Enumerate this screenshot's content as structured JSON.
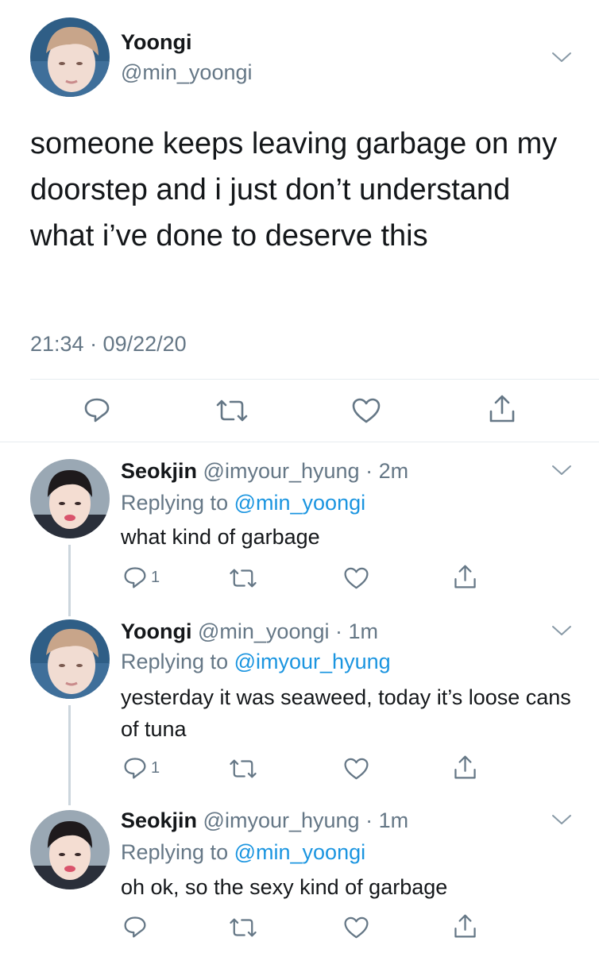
{
  "main_tweet": {
    "display_name": "Yoongi",
    "handle": "@min_yoongi",
    "text": "someone keeps leaving garbage on my doorstep and i just don’t understand what i’ve done to deserve this",
    "timestamp": "21:34 · 09/22/20"
  },
  "replies": [
    {
      "display_name": "Seokjin",
      "handle": "@imyour_hyung",
      "time": "· 2m",
      "replying_label": "Replying to",
      "replying_to": "@min_yoongi",
      "text": "what kind of garbage",
      "reply_count": "1"
    },
    {
      "display_name": "Yoongi",
      "handle": "@min_yoongi",
      "time": "· 1m",
      "replying_label": "Replying to",
      "replying_to": "@imyour_hyung",
      "text": "yesterday it was seaweed, today it’s loose cans of tuna",
      "reply_count": "1"
    },
    {
      "display_name": "Seokjin",
      "handle": "@imyour_hyung",
      "time": "· 1m",
      "replying_label": "Replying to",
      "replying_to": "@min_yoongi",
      "text": "oh ok, so the sexy kind of garbage",
      "reply_count": ""
    }
  ],
  "icons": {
    "reply": "reply-icon",
    "retweet": "retweet-icon",
    "like": "heart-icon",
    "share": "share-icon",
    "more": "chevron-down-icon"
  },
  "colors": {
    "text": "#14171a",
    "secondary": "#657786",
    "link": "#1b95e0",
    "divider": "#e6ecf0",
    "thread_line": "#ccd6dd"
  }
}
